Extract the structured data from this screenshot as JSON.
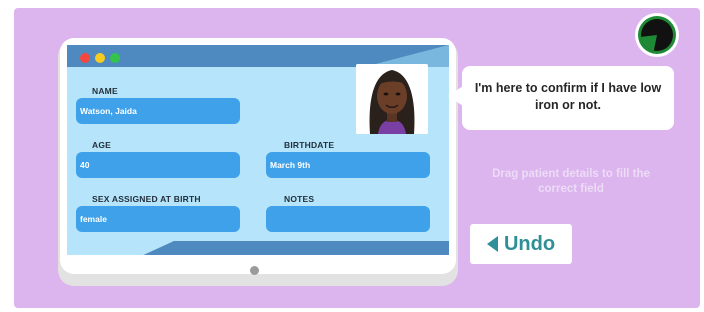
{
  "window": {
    "controls": [
      "close",
      "minimize",
      "maximize"
    ]
  },
  "form": {
    "name": {
      "label": "NAME",
      "value": "Watson, Jaida"
    },
    "age": {
      "label": "AGE",
      "value": "40"
    },
    "birthdate": {
      "label": "BIRTHDATE",
      "value": "March 9th"
    },
    "sex": {
      "label": "SEX ASSIGNED AT BIRTH",
      "value": "female"
    },
    "notes": {
      "label": "NOTES",
      "value": ""
    }
  },
  "patient": {
    "speech": "I'm here to confirm if I have low iron or not."
  },
  "instruction": "Drag patient details to fill the correct field",
  "undo_label": "Undo",
  "timer": {
    "remaining_fraction": 0.8
  },
  "colors": {
    "background": "#dcb4ee",
    "screen": "#b6e5fb",
    "field": "#3ea1ea",
    "header_bar": "#4e89bf",
    "undo_text": "#2f8f96",
    "timer_fill": "#1f8a35"
  }
}
